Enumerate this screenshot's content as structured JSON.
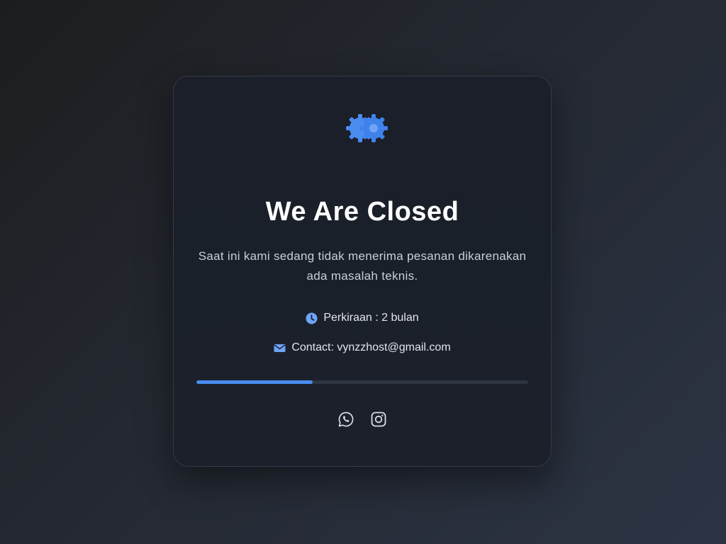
{
  "card": {
    "title": "We Are Closed",
    "description": "Saat ini kami sedang tidak menerima pesanan dikarenakan ada masalah teknis.",
    "estimate_text": "Perkiraan : 2 bulan",
    "contact_text": "Contact: vynzzhost@gmail.com",
    "progress_percent": 35,
    "icons": {
      "logo": "gears-icon",
      "estimate": "clock-icon",
      "contact": "envelope-icon",
      "social": [
        "whatsapp-icon",
        "instagram-icon"
      ]
    }
  },
  "colors": {
    "accent": "#4a8cf0",
    "card_bg": "#1a1f2a",
    "text_primary": "#ffffff",
    "text_secondary": "#c9ced8"
  }
}
